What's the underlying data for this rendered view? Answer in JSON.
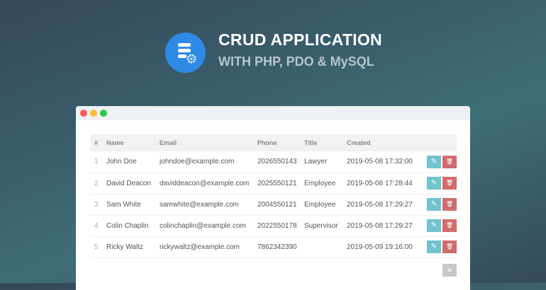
{
  "header": {
    "title": "CRUD APPLICATION",
    "subtitle": "WITH PHP, PDO & MySQL"
  },
  "table": {
    "columns": [
      "#",
      "Name",
      "Email",
      "Phone",
      "Title",
      "Created"
    ],
    "rows": [
      [
        "1",
        "John Doe",
        "johndoe@example.com",
        "2026550143",
        "Lawyer",
        "2019-05-08 17:32:00"
      ],
      [
        "2",
        "David Deacon",
        "daviddeacon@example.com",
        "2025550121",
        "Employee",
        "2019-05-08 17:28:44"
      ],
      [
        "3",
        "Sam White",
        "samwhite@example.com",
        "2004550121",
        "Employee",
        "2019-05-08 17:29:27"
      ],
      [
        "4",
        "Colin Chaplin",
        "colinchaplin@example.com",
        "2022550178",
        "Supervisor",
        "2019-05-08 17:29:27"
      ],
      [
        "5",
        "Ricky Waltz",
        "rickywaltz@example.com",
        "7862342390",
        "",
        "2019-05-09 19:16:00"
      ]
    ]
  },
  "pagination": {
    "next": "»"
  },
  "icons": {
    "edit": "✎",
    "delete": "🗑"
  }
}
